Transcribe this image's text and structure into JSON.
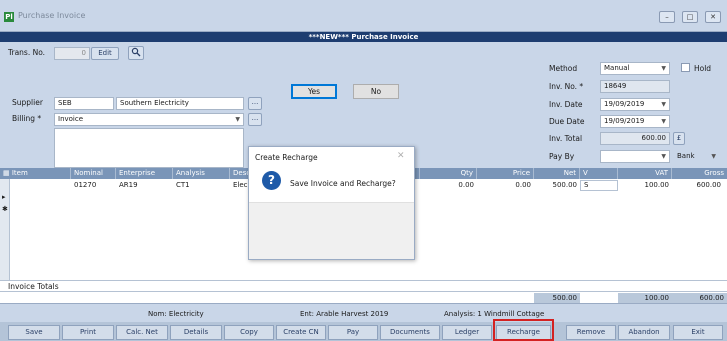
{
  "window": {
    "title": "Purchase Invoice",
    "app_icon": "Pl",
    "banner": "***NEW*** Purchase Invoice",
    "controls": [
      "–",
      "□",
      "✕"
    ]
  },
  "header": {
    "trans_no_label": "Trans. No.",
    "trans_no_value": "0",
    "edit_label": "Edit",
    "supplier_label": "Supplier",
    "supplier_code": "SEB",
    "supplier_name": "Southern Electricity",
    "billing_label": "Billing *",
    "billing_value": "Invoice",
    "method_label": "Method",
    "method_value": "Manual",
    "hold_label": "Hold",
    "inv_no_label": "Inv. No. *",
    "inv_no_value": "18649",
    "inv_date_label": "Inv. Date",
    "inv_date_value": "19/09/2019",
    "due_date_label": "Due Date",
    "due_date_value": "19/09/2019",
    "inv_total_label": "Inv. Total",
    "inv_total_value": "600.00",
    "currency_symbol": "£",
    "pay_by_label": "Pay By",
    "pay_by_value": "",
    "bank_value": "Bank",
    "ellipsis": "..."
  },
  "grid": {
    "columns": [
      "Item",
      "Nominal",
      "Enterprise",
      "Analysis",
      "Desc",
      "Qty",
      "Price",
      "Net",
      "V",
      "VAT",
      "Gross"
    ],
    "row": {
      "nominal": "01270",
      "enterprise": "AR19",
      "analysis": "CT1",
      "desc": "Elec",
      "qty": "0.00",
      "price": "0.00",
      "net": "500.00",
      "vat_code": "S",
      "vat": "100.00",
      "gross": "600.00"
    },
    "row_marker": "▸",
    "new_marker": "✱"
  },
  "totals": {
    "label": "Invoice Totals",
    "net": "500.00",
    "vat": "100.00",
    "gross": "600.00"
  },
  "status": {
    "nom": "Nom: Electricity",
    "ent": "Ent: Arable Harvest 2019",
    "analysis": "Analysis: 1 Windmill Cottage"
  },
  "toolbar": [
    "Save",
    "Print",
    "Calc. Net",
    "Details",
    "Copy",
    "Create CN",
    "Pay",
    "Documents",
    "Ledger",
    "Recharge",
    "Remove",
    "Abandon",
    "Exit"
  ],
  "dialog": {
    "title": "Create Recharge",
    "close": "✕",
    "icon": "?",
    "message": "Save Invoice and Recharge?",
    "yes": "Yes",
    "no": "No"
  },
  "colors": {
    "background": "#5e3a8f",
    "panel": "#c9d6e8",
    "banner": "#1d3d70",
    "grid_header": "#7a95b8",
    "highlight": "#d32222"
  }
}
